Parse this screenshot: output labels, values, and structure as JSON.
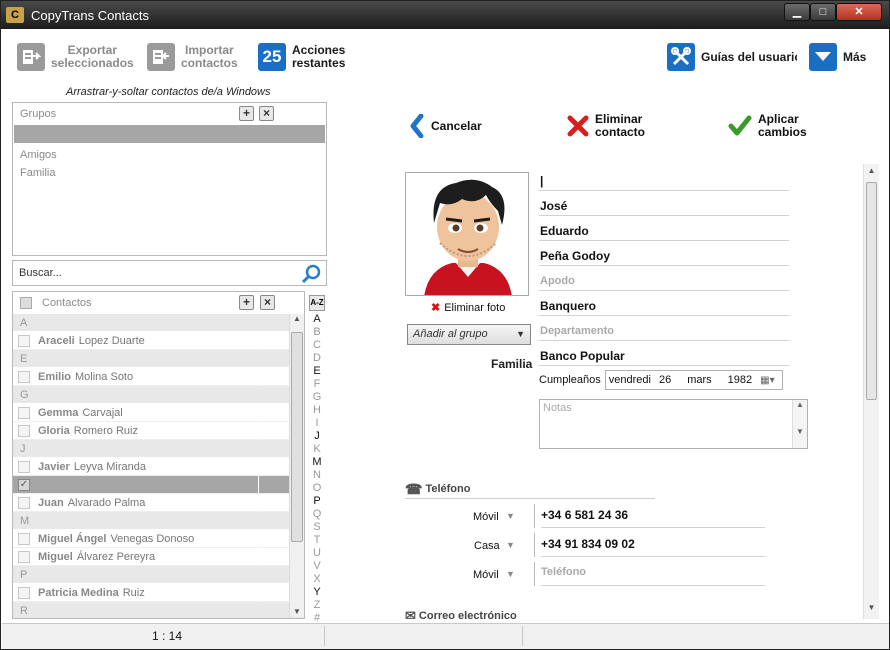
{
  "window": {
    "title": "CopyTrans Contacts",
    "icon_text": "C",
    "minimize": "▁",
    "maximize": "□",
    "close": "✕"
  },
  "toolbar": {
    "export_label_1": "Exportar",
    "export_label_2": "seleccionados",
    "import_label_1": "Importar",
    "import_label_2": "contactos",
    "actions_count": "25",
    "actions_label_1": "Acciones",
    "actions_label_2": "restantes",
    "guides_label": "Guías del usuario",
    "more_label": "Más"
  },
  "drag_hint": "Arrastrar-y-soltar contactos de/a Windows",
  "groups": {
    "header": "Grupos",
    "items": [
      "Amigos",
      "Familia"
    ]
  },
  "search": {
    "placeholder": "Buscar..."
  },
  "contacts": {
    "header": "Contactos",
    "rows": [
      {
        "type": "letter",
        "text": "A"
      },
      {
        "type": "contact",
        "first": "Araceli",
        "last": "Lopez Duarte"
      },
      {
        "type": "letter",
        "text": "E"
      },
      {
        "type": "contact",
        "first": "Emilio",
        "last": "Molina Soto"
      },
      {
        "type": "letter",
        "text": "G"
      },
      {
        "type": "contact",
        "first": "Gemma",
        "last": "Carvajal"
      },
      {
        "type": "contact",
        "first": "Gloria",
        "last": "Romero Ruiz"
      },
      {
        "type": "letter",
        "text": "J"
      },
      {
        "type": "contact",
        "first": "Javier",
        "last": "Leyva Miranda"
      },
      {
        "type": "selected",
        "first": "",
        "last": ""
      },
      {
        "type": "contact",
        "first": "Juan",
        "last": "Alvarado Palma"
      },
      {
        "type": "letter",
        "text": "M"
      },
      {
        "type": "contact",
        "first": "Miguel Ángel",
        "last": "Venegas Donoso"
      },
      {
        "type": "contact",
        "first": "Miguel",
        "last": "Álvarez Pereyra"
      },
      {
        "type": "letter",
        "text": "P"
      },
      {
        "type": "contact",
        "first": "Patricia Medina",
        "last": "Ruiz"
      },
      {
        "type": "letter",
        "text": "R"
      }
    ]
  },
  "alphabet": {
    "sort_label": "A-Z",
    "letters": [
      "A",
      "B",
      "C",
      "D",
      "E",
      "F",
      "G",
      "H",
      "I",
      "J",
      "K",
      "M",
      "N",
      "O",
      "P",
      "Q",
      "S",
      "T",
      "U",
      "V",
      "X",
      "Y",
      "Z",
      "#"
    ],
    "active": [
      "A",
      "E",
      "J",
      "M",
      "P",
      "Y"
    ]
  },
  "actions": {
    "cancel": "Cancelar",
    "delete_1": "Eliminar",
    "delete_2": "contacto",
    "apply_1": "Aplicar",
    "apply_2": "cambios"
  },
  "detail": {
    "delete_photo": "Eliminar foto",
    "add_group": "Añadir al grupo",
    "group": "Familia",
    "prefix": "",
    "first_name": "José",
    "middle_name": "Eduardo",
    "last_name": "Peña Godoy",
    "nickname_ph": "Apodo",
    "company": "Banquero",
    "department_ph": "Departamento",
    "organization": "Banco Popular",
    "birthday_label": "Cumpleaños",
    "birthday_weekday": "vendredi",
    "birthday_day": "26",
    "birthday_month": "mars",
    "birthday_year": "1982",
    "notes_ph": "Notas",
    "phone_header": "Teléfono",
    "phones": [
      {
        "type": "Móvil",
        "number": "+34 6 581 24 36"
      },
      {
        "type": "Casa",
        "number": "+34 91 834 09 02"
      },
      {
        "type": "Móvil",
        "number": "Teléfono"
      }
    ],
    "email_header": "Correo electrónico"
  },
  "status": {
    "count": "1 : 14"
  }
}
